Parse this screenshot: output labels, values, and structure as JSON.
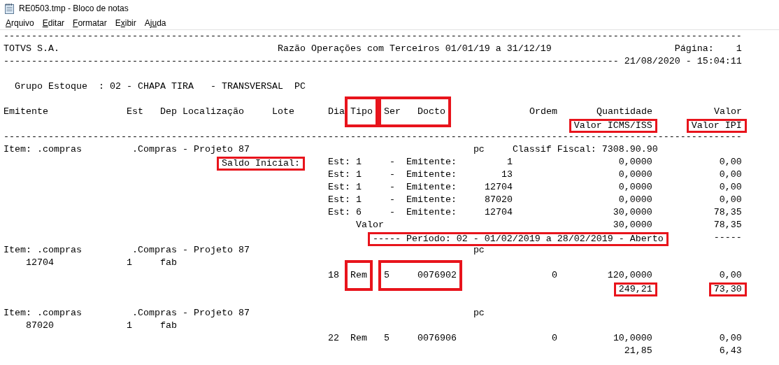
{
  "window": {
    "title": "RE0503.tmp - Bloco de notas"
  },
  "menu": [
    {
      "key": "A",
      "after": "rquivo"
    },
    {
      "key": "E",
      "after": "ditar"
    },
    {
      "key": "F",
      "after": "ormatar"
    },
    {
      "before": "E",
      "key": "x",
      "after": "ibir"
    },
    {
      "before": "Aj",
      "key": "u",
      "after": "da"
    }
  ],
  "lines": [
    {
      "kind": "text",
      "segments": [
        {
          "text": "------------------------------------------------------------------------------------------------------------------------------------",
          "boxed": false
        }
      ]
    },
    {
      "kind": "text",
      "segments": [
        {
          "text": "TOTVS S.A.",
          "boxed": false
        },
        {
          "text": "                                       Razão Operações com Terceiros 01/01/19 a 31/12/19",
          "boxed": false
        },
        {
          "text": "                      Página:    1",
          "boxed": false
        }
      ]
    },
    {
      "kind": "text",
      "segments": [
        {
          "text": "--------------------------------------------------------------------------------------------------------------",
          "boxed": false
        },
        {
          "text": " 21/08/2020 - 15:04:11",
          "boxed": false
        }
      ]
    },
    {
      "kind": "blank"
    },
    {
      "kind": "text",
      "segments": [
        {
          "text": "  Grupo Estoque  : 02 - CHAPA TIRA   - TRANSVERSAL  PC",
          "boxed": false
        }
      ]
    },
    {
      "kind": "blank"
    },
    {
      "kind": "text",
      "segments": [
        {
          "text": "Emitente",
          "boxed": false
        },
        {
          "text": "              Est",
          "boxed": false
        },
        {
          "text": "   Dep",
          "boxed": false
        },
        {
          "text": " Localização",
          "boxed": false
        },
        {
          "text": "     Lote",
          "boxed": false
        },
        {
          "text": "      Dia",
          "boxed": false
        },
        {
          "text": " Tipo",
          "boxed": true,
          "tall": true
        },
        {
          "text": "  Ser   Docto",
          "boxed": true,
          "tall": true
        },
        {
          "text": "               Ordem",
          "boxed": false
        },
        {
          "text": "       Quantidade",
          "boxed": false
        },
        {
          "text": "           Valor",
          "boxed": false
        }
      ]
    },
    {
      "kind": "text",
      "segments": [
        {
          "text": "                                                                                                      Valor ICMS/ISS",
          "boxed": true,
          "tall": false
        },
        {
          "text": "       Valor IPI",
          "boxed": true,
          "tall": false
        }
      ]
    },
    {
      "kind": "text",
      "segments": [
        {
          "text": "------------------------------------------------------------------------------------------------------------------------------------",
          "boxed": false
        }
      ]
    },
    {
      "kind": "text",
      "segments": [
        {
          "text": "Item: .compras",
          "boxed": false
        },
        {
          "text": "         .Compras - Projeto 87",
          "boxed": false
        },
        {
          "text": "                                        pc",
          "boxed": false
        },
        {
          "text": "     Classif Fiscal: 7308.90.90",
          "boxed": false
        }
      ]
    },
    {
      "kind": "text",
      "segments": [
        {
          "text": "                                       Saldo Inicial:",
          "boxed": true,
          "tall": false
        },
        {
          "text": "     Est: 1",
          "boxed": false
        },
        {
          "text": "     -",
          "boxed": false
        },
        {
          "text": "  Emitente:",
          "boxed": false
        },
        {
          "text": "         1",
          "boxed": false
        },
        {
          "text": "                   0,0000",
          "boxed": false
        },
        {
          "text": "            0,00",
          "boxed": false
        }
      ]
    },
    {
      "kind": "text",
      "segments": [
        {
          "text": "                                                          Est: 1",
          "boxed": false
        },
        {
          "text": "     -",
          "boxed": false
        },
        {
          "text": "  Emitente:",
          "boxed": false
        },
        {
          "text": "        13",
          "boxed": false
        },
        {
          "text": "                   0,0000",
          "boxed": false
        },
        {
          "text": "            0,00",
          "boxed": false
        }
      ]
    },
    {
      "kind": "text",
      "segments": [
        {
          "text": "                                                          Est: 1",
          "boxed": false
        },
        {
          "text": "     -",
          "boxed": false
        },
        {
          "text": "  Emitente:",
          "boxed": false
        },
        {
          "text": "     12704",
          "boxed": false
        },
        {
          "text": "                   0,0000",
          "boxed": false
        },
        {
          "text": "            0,00",
          "boxed": false
        }
      ]
    },
    {
      "kind": "text",
      "segments": [
        {
          "text": "                                                          Est: 1",
          "boxed": false
        },
        {
          "text": "     -",
          "boxed": false
        },
        {
          "text": "  Emitente:",
          "boxed": false
        },
        {
          "text": "     87020",
          "boxed": false
        },
        {
          "text": "                   0,0000",
          "boxed": false
        },
        {
          "text": "            0,00",
          "boxed": false
        }
      ]
    },
    {
      "kind": "text",
      "segments": [
        {
          "text": "                                                          Est: 6",
          "boxed": false
        },
        {
          "text": "     -",
          "boxed": false
        },
        {
          "text": "  Emitente:",
          "boxed": false
        },
        {
          "text": "     12704",
          "boxed": false
        },
        {
          "text": "                  30,0000",
          "boxed": false
        },
        {
          "text": "           78,35",
          "boxed": false
        }
      ]
    },
    {
      "kind": "text",
      "segments": [
        {
          "text": "                                                               Valor",
          "boxed": false
        },
        {
          "text": "                                         30,0000",
          "boxed": false
        },
        {
          "text": "           78,35",
          "boxed": false
        }
      ]
    },
    {
      "kind": "text",
      "segments": [
        {
          "text": "                                                                  ----- Período: 02 - 01/02/2019 a 28/02/2019 - Aberto",
          "boxed": true,
          "tall": false
        },
        {
          "text": "         -----",
          "boxed": false
        }
      ]
    },
    {
      "kind": "text",
      "segments": [
        {
          "text": "Item: .compras",
          "boxed": false
        },
        {
          "text": "         .Compras - Projeto 87",
          "boxed": false
        },
        {
          "text": "                                        pc",
          "boxed": false
        }
      ]
    },
    {
      "kind": "text",
      "segments": [
        {
          "text": "    12704",
          "boxed": false
        },
        {
          "text": "             1",
          "boxed": false
        },
        {
          "text": "     fab",
          "boxed": false
        }
      ]
    },
    {
      "kind": "text",
      "segments": [
        {
          "text": "                                                          18",
          "boxed": false
        },
        {
          "text": "  Rem",
          "boxed": true,
          "tall": true
        },
        {
          "text": "   5     0076902",
          "boxed": true,
          "tall": true
        },
        {
          "text": "                 0",
          "boxed": false
        },
        {
          "text": "         120,0000",
          "boxed": false
        },
        {
          "text": "            0,00",
          "boxed": false
        }
      ]
    },
    {
      "kind": "text",
      "segments": [
        {
          "text": "                                                                                                              249,21",
          "boxed": true,
          "tall": false
        },
        {
          "text": "           73,30",
          "boxed": true,
          "tall": false
        }
      ]
    },
    {
      "kind": "blank"
    },
    {
      "kind": "text",
      "segments": [
        {
          "text": "Item: .compras",
          "boxed": false
        },
        {
          "text": "         .Compras - Projeto 87",
          "boxed": false
        },
        {
          "text": "                                        pc",
          "boxed": false
        }
      ]
    },
    {
      "kind": "text",
      "segments": [
        {
          "text": "    87020",
          "boxed": false
        },
        {
          "text": "             1",
          "boxed": false
        },
        {
          "text": "     fab",
          "boxed": false
        }
      ]
    },
    {
      "kind": "text",
      "segments": [
        {
          "text": "                                                          22",
          "boxed": false
        },
        {
          "text": "  Rem",
          "boxed": false
        },
        {
          "text": "   5",
          "boxed": false
        },
        {
          "text": "     0076906",
          "boxed": false
        },
        {
          "text": "                 0",
          "boxed": false
        },
        {
          "text": "          10,0000",
          "boxed": false
        },
        {
          "text": "            0,00",
          "boxed": false
        }
      ]
    },
    {
      "kind": "text",
      "segments": [
        {
          "text": "                                                                                                               21,85",
          "boxed": false
        },
        {
          "text": "            6,43",
          "boxed": false
        }
      ]
    }
  ]
}
